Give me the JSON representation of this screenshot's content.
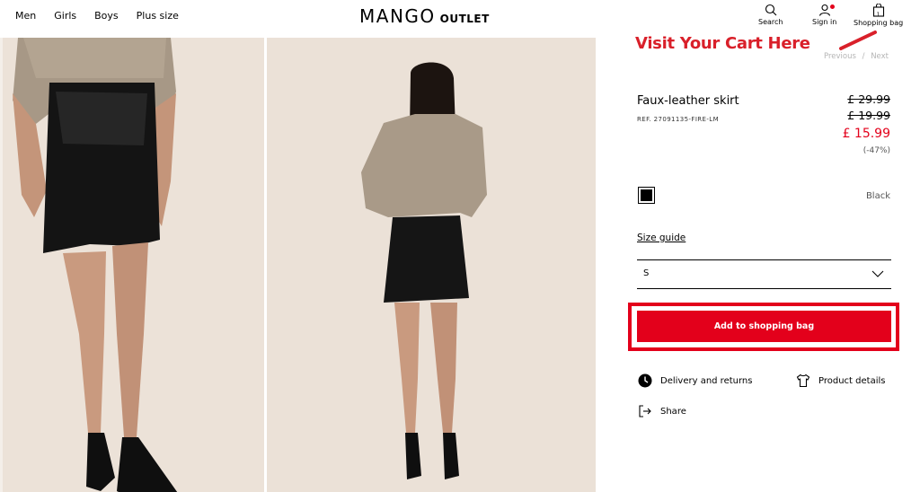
{
  "header": {
    "nav": [
      "Men",
      "Girls",
      "Boys",
      "Plus size"
    ],
    "logo_main": "MANGO",
    "logo_sub": "OUTLET",
    "search_label": "Search",
    "signin_label": "Sign in",
    "bag_label": "Shopping bag",
    "bag_count": "1"
  },
  "annotation": {
    "text": "Visit Your Cart Here",
    "color": "#d9202a"
  },
  "pager": {
    "previous": "Previous",
    "separator": "/",
    "next": "Next"
  },
  "product": {
    "title": "Faux-leather skirt",
    "ref": "REF. 27091135-FIRE-LM",
    "price_original": "£ 29.99",
    "price_previous": "£ 19.99",
    "price_current": "£ 15.99",
    "discount": "(-47%)",
    "color_name": "Black",
    "size_guide": "Size guide",
    "selected_size": "S",
    "add_button": "Add to shopping bag",
    "delivery": "Delivery and returns",
    "details": "Product details",
    "share": "Share"
  },
  "colors": {
    "accent": "#e3001b",
    "swatch": "#000000"
  },
  "icons": [
    "search-icon",
    "user-icon",
    "bag-icon",
    "chevron-down-icon",
    "clock-icon",
    "shirt-icon",
    "share-icon"
  ]
}
